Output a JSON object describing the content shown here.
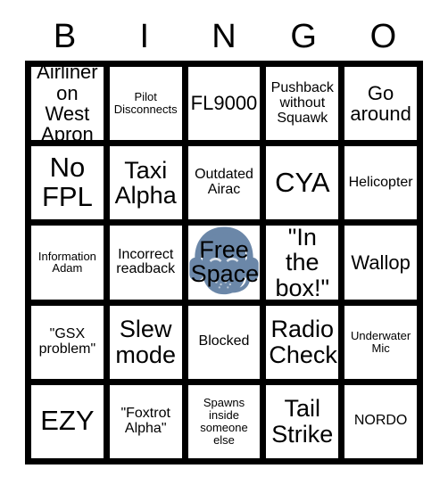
{
  "card": {
    "title": "BINGO",
    "header_letters": [
      "B",
      "I",
      "N",
      "G",
      "O"
    ],
    "colors": {
      "background": "#ffffff",
      "border": "#000000",
      "text": "#000000",
      "free_space_art": "#6b87a8"
    },
    "free_space": {
      "label": "Free\nSpace",
      "icon": "headset-person-icon"
    },
    "rows": [
      [
        {
          "text": "Airliner\non West\nApron",
          "size": "md"
        },
        {
          "text": "Pilot\nDisconnects",
          "size": "xs"
        },
        {
          "text": "FL9000",
          "size": "md"
        },
        {
          "text": "Pushback\nwithout\nSquawk",
          "size": "sm"
        },
        {
          "text": "Go\naround",
          "size": "md"
        }
      ],
      [
        {
          "text": "No\nFPL",
          "size": "xl"
        },
        {
          "text": "Taxi\nAlpha",
          "size": "lg"
        },
        {
          "text": "Outdated\nAirac",
          "size": "sm"
        },
        {
          "text": "CYA",
          "size": "xl"
        },
        {
          "text": "Helicopter",
          "size": "sm"
        }
      ],
      [
        {
          "text": "Information\nAdam",
          "size": "xs"
        },
        {
          "text": "Incorrect\nreadback",
          "size": "sm"
        },
        {
          "text": "Free\nSpace",
          "size": "lg",
          "free": true
        },
        {
          "text": "\"In the\nbox!\"",
          "size": "lg"
        },
        {
          "text": "Wallop",
          "size": "md"
        }
      ],
      [
        {
          "text": "\"GSX\nproblem\"",
          "size": "sm"
        },
        {
          "text": "Slew\nmode",
          "size": "lg"
        },
        {
          "text": "Blocked",
          "size": "sm"
        },
        {
          "text": "Radio\nCheck",
          "size": "lg"
        },
        {
          "text": "Underwater\nMic",
          "size": "xs"
        }
      ],
      [
        {
          "text": "EZY",
          "size": "xl"
        },
        {
          "text": "\"Foxtrot\nAlpha\"",
          "size": "sm"
        },
        {
          "text": "Spawns\ninside\nsomeone\nelse",
          "size": "xs"
        },
        {
          "text": "Tail\nStrike",
          "size": "lg"
        },
        {
          "text": "NORDO",
          "size": "sm"
        }
      ]
    ]
  }
}
